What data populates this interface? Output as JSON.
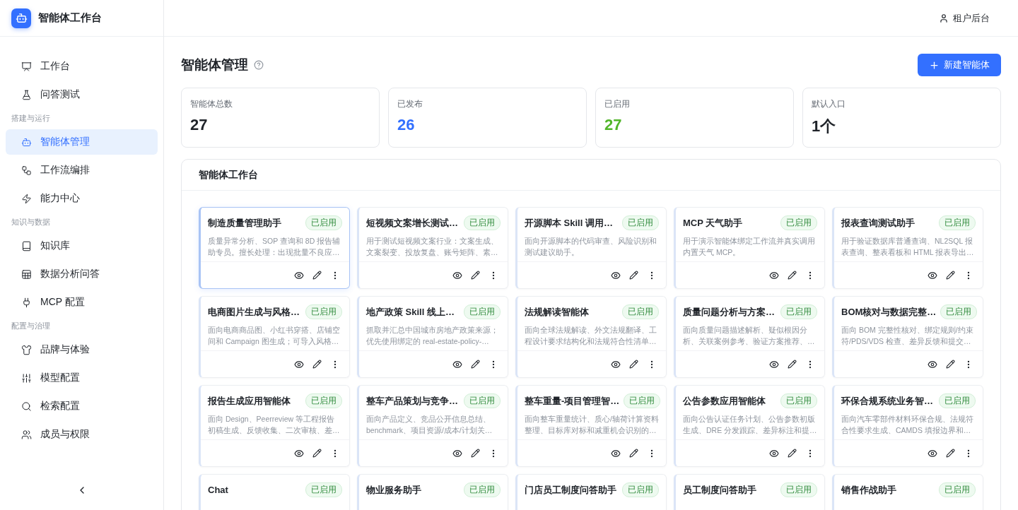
{
  "app": {
    "title": "智能体工作台"
  },
  "header": {
    "tenant_link": "租户后台"
  },
  "sidebar": {
    "items": [
      {
        "kind": "item",
        "label": "工作台",
        "selected": false
      },
      {
        "kind": "item",
        "label": "问答测试",
        "selected": false
      },
      {
        "kind": "section",
        "label": "搭建与运行"
      },
      {
        "kind": "item",
        "label": "智能体管理",
        "selected": true
      },
      {
        "kind": "item",
        "label": "工作流编排",
        "selected": false
      },
      {
        "kind": "item",
        "label": "能力中心",
        "selected": false
      },
      {
        "kind": "section",
        "label": "知识与数据"
      },
      {
        "kind": "item",
        "label": "知识库",
        "selected": false
      },
      {
        "kind": "item",
        "label": "数据分析问答",
        "selected": false
      },
      {
        "kind": "item",
        "label": "MCP 配置",
        "selected": false
      },
      {
        "kind": "section",
        "label": "配置与治理"
      },
      {
        "kind": "item",
        "label": "品牌与体验",
        "selected": false
      },
      {
        "kind": "item",
        "label": "模型配置",
        "selected": false
      },
      {
        "kind": "item",
        "label": "检索配置",
        "selected": false
      },
      {
        "kind": "item",
        "label": "成员与权限",
        "selected": false
      }
    ]
  },
  "page": {
    "title": "智能体管理",
    "new_button": "新建智能体"
  },
  "stats": [
    {
      "label": "智能体总数",
      "value": "27",
      "color": "#1f2329"
    },
    {
      "label": "已发布",
      "value": "26",
      "color": "#3370ff"
    },
    {
      "label": "已启用",
      "value": "27",
      "color": "#52b62a"
    },
    {
      "label": "默认入口",
      "value": "1个",
      "color": "#1f2329"
    }
  ],
  "panel": {
    "title": "智能体工作台"
  },
  "agents": [
    {
      "name": "制造质量管理助手",
      "status": "已启用",
      "description": "质量异常分析、SOP 查询和 8D 报告辅助专员。擅长处理：出现批量不良应…",
      "selected": true
    },
    {
      "name": "短视频文案增长测试…",
      "status": "已启用",
      "description": "用于测试短视频文案行业：文案生成、文案裂变、投放复盘、账号矩阵、素…",
      "selected": false
    },
    {
      "name": "开源脚本 Skill 调用…",
      "status": "已启用",
      "description": "面向开源脚本的代码审查、风险识别和测试建议助手。",
      "selected": false
    },
    {
      "name": "MCP 天气助手",
      "status": "已启用",
      "description": "用于演示智能体绑定工作流并真实调用内置天气 MCP。",
      "selected": false
    },
    {
      "name": "报表查询测试助手",
      "status": "已启用",
      "description": "用于验证数据库普通查询、NL2SQL 报表查询、整表看板和 HTML 报表导出…",
      "selected": false
    },
    {
      "name": "电商图片生成与风格…",
      "status": "已启用",
      "description": "面向电商商品图、小红书穿搭、店铺空间和 Campaign 图生成；可导入风格…",
      "selected": false
    },
    {
      "name": "地产政策 Skill 线上…",
      "status": "已启用",
      "description": "抓取并汇总中国城市房地产政策来源；优先使用绑定的 real-estate-policy-…",
      "selected": false
    },
    {
      "name": "法规解读智能体",
      "status": "已启用",
      "description": "面向全球法规解读、外文法规翻译、工程设计要求结构化和法规符合性清单…",
      "selected": false
    },
    {
      "name": "质量问题分析与方案…",
      "status": "已启用",
      "description": "面向质量问题描述解析、疑似根因分析、关联案例参考、验证方案推荐、…",
      "selected": false
    },
    {
      "name": "BOM核对与数据完整…",
      "status": "已启用",
      "description": "面向 BOM 完整性核对、绑定规则/约束符/PDS/VDS 检查、差异反馈和提交…",
      "selected": false
    },
    {
      "name": "报告生成应用智能体",
      "status": "已启用",
      "description": "面向 Design、Peerreview 等工程报告初稿生成、反馈收集、二次审核、差…",
      "selected": false
    },
    {
      "name": "整车产品策划与竞争…",
      "status": "已启用",
      "description": "面向产品定义、竞品公开信息总结、benchmark、项目资源/成本/计划关…",
      "selected": false
    },
    {
      "name": "整车重量-项目管理智…",
      "status": "已启用",
      "description": "面向整车重量统计、质心/轴荷计算资料整理、目标库对标和减重机会识别的…",
      "selected": false
    },
    {
      "name": "公告参数应用智能体",
      "status": "已启用",
      "description": "面向公告认证任务计划、公告参数初版生成、DRE 分发跟踪、差异标注和提…",
      "selected": false
    },
    {
      "name": "环保合规系统业务智…",
      "status": "已启用",
      "description": "面向汽车零部件材料环保合规、法规符合性要求生成、CAMDS 填报边界和…",
      "selected": false
    },
    {
      "name": "Chat",
      "status": "已启用",
      "selected": false
    },
    {
      "name": "物业服务助手",
      "status": "已启用",
      "selected": false
    },
    {
      "name": "门店员工制度问答助手",
      "status": "已启用",
      "selected": false
    },
    {
      "name": "员工制度问答助手",
      "status": "已启用",
      "selected": false
    },
    {
      "name": "销售作战助手",
      "status": "已启用",
      "selected": false
    }
  ]
}
